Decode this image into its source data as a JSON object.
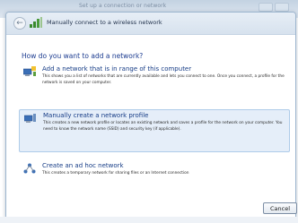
{
  "window": {
    "title": "Manually connect to a wireless network",
    "background_title": "Set up a connection or network"
  },
  "main": {
    "heading": "How do you want to add a network?",
    "options": [
      {
        "title": "Add a network that is in range of this computer",
        "description": "This shows you a list of networks that are currently available and lets you connect to one. Once you connect, a profile for the network is saved on your computer.",
        "icon": "network-add-icon"
      },
      {
        "title": "Manually create a network profile",
        "description": "This creates a new network profile or locates an existing network and saves a profile for the network on your computer. You need to know the network name (SSID) and security key (if applicable).",
        "icon": "network-profile-icon",
        "selected": true
      },
      {
        "title": "Create an ad hoc network",
        "description": "This creates a temporary network for sharing files or an Internet connection",
        "icon": "ad-hoc-network-icon"
      }
    ]
  },
  "footer": {
    "cancel_label": "Cancel"
  },
  "colors": {
    "heading": "#1a3a8f",
    "link": "#163c86",
    "selection_bg": "#e5eef9",
    "selection_border": "#aecbe9"
  }
}
